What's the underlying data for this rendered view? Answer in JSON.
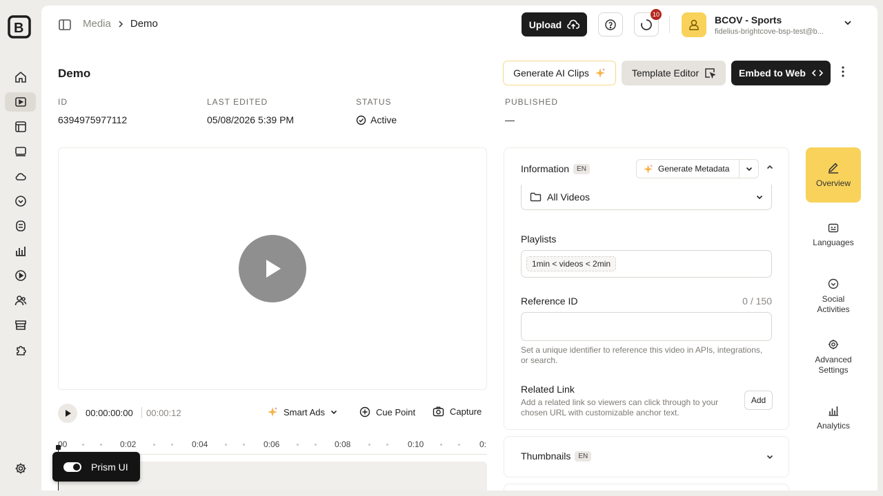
{
  "rail": {
    "items": [
      "home",
      "media",
      "playlists",
      "players",
      "cloud",
      "social",
      "ai-studio",
      "analytics",
      "live",
      "audience",
      "store",
      "plugins"
    ],
    "active": "media",
    "settings": "settings"
  },
  "header": {
    "breadcrumb": [
      "Media",
      "Demo"
    ],
    "upload_label": "Upload",
    "notification_count": "10",
    "account_name": "BCOV - Sports",
    "account_email": "fidelius-brightcove-bsp-test@b..."
  },
  "title_row": {
    "title": "Demo",
    "ai_clips_label": "Generate AI Clips",
    "template_label": "Template Editor",
    "embed_label": "Embed to Web"
  },
  "meta": {
    "id_label": "ID",
    "id_value": "6394975977112",
    "edited_label": "LAST EDITED",
    "edited_value": "05/08/2026 5:39 PM",
    "status_label": "STATUS",
    "status_value": "Active",
    "published_label": "PUBLISHED",
    "published_value": "—"
  },
  "player": {
    "current_time": "00:00:00:00",
    "total_time": "00:00:12",
    "smart_ads_label": "Smart Ads",
    "cue_point_label": "Cue Point",
    "capture_label": "Capture",
    "ticks": [
      "00",
      "0:02",
      "0:04",
      "0:06",
      "0:08",
      "0:10",
      "0:"
    ]
  },
  "info": {
    "title": "Information",
    "lang": "EN",
    "generate_label": "Generate Metadata",
    "folder_value": "All Videos",
    "playlists_label": "Playlists",
    "playlist_chip": "1min < videos < 2min",
    "ref_label": "Reference ID",
    "ref_count": "0 / 150",
    "ref_help": "Set a unique identifier to reference this video in APIs, integrations, or search.",
    "related_label": "Related Link",
    "related_help": "Add a related link so viewers can click through to your chosen URL with customizable anchor text.",
    "add_label": "Add"
  },
  "thumbnails": {
    "title": "Thumbnails",
    "lang": "EN"
  },
  "side_tabs": {
    "overview": "Overview",
    "languages": "Languages",
    "social": "Social Activities",
    "advanced": "Advanced Settings",
    "analytics": "Analytics"
  },
  "prism": {
    "label": "Prism UI"
  },
  "colors": {
    "accent_yellow": "#f8d25a",
    "dark": "#1d1d1d",
    "badge_red": "#b3261e"
  }
}
